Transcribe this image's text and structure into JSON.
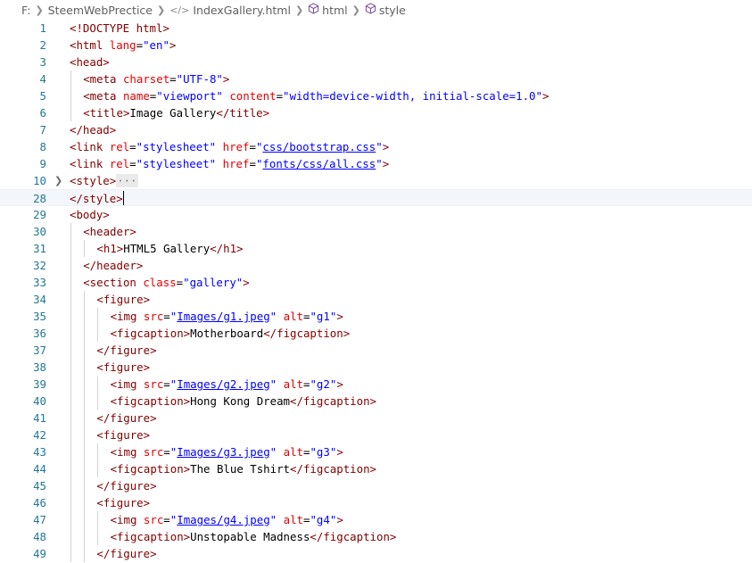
{
  "breadcrumb": {
    "drive": "F:",
    "folder": "SteemWebPrectice",
    "file": "IndexGallery.html",
    "html_node": "html",
    "style_node": "style"
  },
  "lines": [
    {
      "n": "1",
      "indent": 0,
      "tokens": [
        [
          "t",
          "<!DOCTYPE "
        ],
        [
          "d",
          "html"
        ],
        [
          "t",
          ">"
        ]
      ]
    },
    {
      "n": "2",
      "indent": 0,
      "tokens": [
        [
          "t",
          "<html "
        ],
        [
          "a",
          "lang"
        ],
        [
          "",
          "="
        ],
        [
          "s",
          "\"en\""
        ],
        [
          "t",
          ">"
        ]
      ]
    },
    {
      "n": "3",
      "indent": 0,
      "tokens": [
        [
          "t",
          "<head>"
        ]
      ]
    },
    {
      "n": "4",
      "indent": 1,
      "tokens": [
        [
          "t",
          "<meta "
        ],
        [
          "a",
          "charset"
        ],
        [
          "",
          "="
        ],
        [
          "s",
          "\"UTF-8\""
        ],
        [
          "t",
          ">"
        ]
      ]
    },
    {
      "n": "5",
      "indent": 1,
      "tokens": [
        [
          "t",
          "<meta "
        ],
        [
          "a",
          "name"
        ],
        [
          "",
          "="
        ],
        [
          "s",
          "\"viewport\""
        ],
        [
          "",
          " "
        ],
        [
          "a",
          "content"
        ],
        [
          "",
          "="
        ],
        [
          "s",
          "\"width=device-width, initial-scale=1.0\""
        ],
        [
          "t",
          ">"
        ]
      ]
    },
    {
      "n": "6",
      "indent": 1,
      "tokens": [
        [
          "t",
          "<title>"
        ],
        [
          "",
          "Image Gallery"
        ],
        [
          "t",
          "</title>"
        ]
      ]
    },
    {
      "n": "7",
      "indent": 0,
      "tokens": [
        [
          "t",
          "</head>"
        ]
      ]
    },
    {
      "n": "8",
      "indent": 0,
      "tokens": [
        [
          "t",
          "<link "
        ],
        [
          "a",
          "rel"
        ],
        [
          "",
          "="
        ],
        [
          "s",
          "\"stylesheet\""
        ],
        [
          "",
          " "
        ],
        [
          "a",
          "href"
        ],
        [
          "",
          "="
        ],
        [
          "s",
          "\""
        ],
        [
          "l",
          "css/bootstrap.css"
        ],
        [
          "s",
          "\""
        ],
        [
          "t",
          ">"
        ]
      ]
    },
    {
      "n": "9",
      "indent": 0,
      "tokens": [
        [
          "t",
          "<link "
        ],
        [
          "a",
          "rel"
        ],
        [
          "",
          "="
        ],
        [
          "s",
          "\"stylesheet\""
        ],
        [
          "",
          " "
        ],
        [
          "a",
          "href"
        ],
        [
          "",
          "="
        ],
        [
          "s",
          "\""
        ],
        [
          "l",
          "fonts/css/all.css"
        ],
        [
          "s",
          "\""
        ],
        [
          "t",
          ">"
        ]
      ]
    },
    {
      "n": "10",
      "indent": 0,
      "folded": true,
      "tokens": [
        [
          "t",
          "<style>"
        ],
        [
          "dots",
          "···"
        ]
      ]
    },
    {
      "n": "28",
      "indent": 0,
      "current": true,
      "tokens": [
        [
          "t",
          "</style>"
        ],
        [
          "cursor",
          ""
        ]
      ]
    },
    {
      "n": "29",
      "indent": 0,
      "tokens": [
        [
          "t",
          "<body>"
        ]
      ]
    },
    {
      "n": "30",
      "indent": 1,
      "tokens": [
        [
          "t",
          "<header>"
        ]
      ]
    },
    {
      "n": "31",
      "indent": 2,
      "tokens": [
        [
          "t",
          "<h1>"
        ],
        [
          "",
          "HTML5 Gallery"
        ],
        [
          "t",
          "</h1>"
        ]
      ]
    },
    {
      "n": "32",
      "indent": 1,
      "tokens": [
        [
          "t",
          "</header>"
        ]
      ]
    },
    {
      "n": "33",
      "indent": 1,
      "tokens": [
        [
          "t",
          "<section "
        ],
        [
          "a",
          "class"
        ],
        [
          "",
          "="
        ],
        [
          "s",
          "\"gallery\""
        ],
        [
          "t",
          ">"
        ]
      ]
    },
    {
      "n": "34",
      "indent": 2,
      "tokens": [
        [
          "t",
          "<figure>"
        ]
      ]
    },
    {
      "n": "35",
      "indent": 3,
      "tokens": [
        [
          "t",
          "<img "
        ],
        [
          "a",
          "src"
        ],
        [
          "",
          "="
        ],
        [
          "s",
          "\""
        ],
        [
          "l",
          "Images/g1.jpeg"
        ],
        [
          "s",
          "\""
        ],
        [
          "",
          " "
        ],
        [
          "a",
          "alt"
        ],
        [
          "",
          "="
        ],
        [
          "s",
          "\"g1\""
        ],
        [
          "t",
          ">"
        ]
      ]
    },
    {
      "n": "36",
      "indent": 3,
      "tokens": [
        [
          "t",
          "<figcaption>"
        ],
        [
          "",
          "Motherboard"
        ],
        [
          "t",
          "</figcaption>"
        ]
      ]
    },
    {
      "n": "37",
      "indent": 2,
      "tokens": [
        [
          "t",
          "</figure>"
        ]
      ]
    },
    {
      "n": "38",
      "indent": 2,
      "tokens": [
        [
          "t",
          "<figure>"
        ]
      ]
    },
    {
      "n": "39",
      "indent": 3,
      "tokens": [
        [
          "t",
          "<img "
        ],
        [
          "a",
          "src"
        ],
        [
          "",
          "="
        ],
        [
          "s",
          "\""
        ],
        [
          "l",
          "Images/g2.jpeg"
        ],
        [
          "s",
          "\""
        ],
        [
          "",
          " "
        ],
        [
          "a",
          "alt"
        ],
        [
          "",
          "="
        ],
        [
          "s",
          "\"g2\""
        ],
        [
          "t",
          ">"
        ]
      ]
    },
    {
      "n": "40",
      "indent": 3,
      "tokens": [
        [
          "t",
          "<figcaption>"
        ],
        [
          "",
          "Hong Kong Dream"
        ],
        [
          "t",
          "</figcaption>"
        ]
      ]
    },
    {
      "n": "41",
      "indent": 2,
      "tokens": [
        [
          "t",
          "</figure>"
        ]
      ]
    },
    {
      "n": "42",
      "indent": 2,
      "tokens": [
        [
          "t",
          "<figure>"
        ]
      ]
    },
    {
      "n": "43",
      "indent": 3,
      "tokens": [
        [
          "t",
          "<img "
        ],
        [
          "a",
          "src"
        ],
        [
          "",
          "="
        ],
        [
          "s",
          "\""
        ],
        [
          "l",
          "Images/g3.jpeg"
        ],
        [
          "s",
          "\""
        ],
        [
          "",
          " "
        ],
        [
          "a",
          "alt"
        ],
        [
          "",
          "="
        ],
        [
          "s",
          "\"g3\""
        ],
        [
          "t",
          ">"
        ]
      ]
    },
    {
      "n": "44",
      "indent": 3,
      "tokens": [
        [
          "t",
          "<figcaption>"
        ],
        [
          "",
          "The Blue Tshirt"
        ],
        [
          "t",
          "</figcaption>"
        ]
      ]
    },
    {
      "n": "45",
      "indent": 2,
      "tokens": [
        [
          "t",
          "</figure>"
        ]
      ]
    },
    {
      "n": "46",
      "indent": 2,
      "tokens": [
        [
          "t",
          "<figure>"
        ]
      ]
    },
    {
      "n": "47",
      "indent": 3,
      "tokens": [
        [
          "t",
          "<img "
        ],
        [
          "a",
          "src"
        ],
        [
          "",
          "="
        ],
        [
          "s",
          "\""
        ],
        [
          "l",
          "Images/g4.jpeg"
        ],
        [
          "s",
          "\""
        ],
        [
          "",
          " "
        ],
        [
          "a",
          "alt"
        ],
        [
          "",
          "="
        ],
        [
          "s",
          "\"g4\""
        ],
        [
          "t",
          ">"
        ]
      ]
    },
    {
      "n": "48",
      "indent": 3,
      "tokens": [
        [
          "t",
          "<figcaption>"
        ],
        [
          "",
          "Unstopable Madness"
        ],
        [
          "t",
          "</figcaption>"
        ]
      ]
    },
    {
      "n": "49",
      "indent": 2,
      "tokens": [
        [
          "t",
          "</figure>"
        ]
      ]
    }
  ]
}
